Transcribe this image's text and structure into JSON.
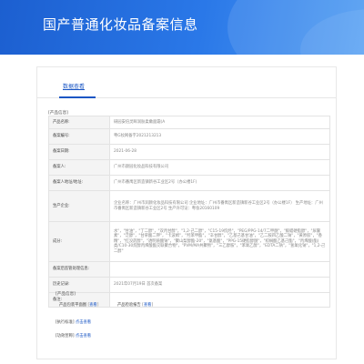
{
  "header": {
    "title": "国产普通化妆品备案信息"
  },
  "tabs": [
    {
      "label": "数据查看"
    }
  ],
  "product_section": {
    "title": "[产品信息]"
  },
  "rows": [
    {
      "label": "产品名称:",
      "value": "研园安倍灵眸润肤柔嫩面霜(A"
    },
    {
      "label": "备案编号:",
      "value": "粤G妆网备字2021213213"
    },
    {
      "label": "备案日期:",
      "value": "2021-06-28"
    },
    {
      "label": "备案人:",
      "value": "广州市颜园化妆品科技有限公司"
    },
    {
      "label": "备案人地址/地址:",
      "value": "广州市番禺区新造镇新谷工业区2号（办公楼1F)"
    },
    {
      "label": "生产企业:",
      "value": "企业名称：广州市润颜化妆品科技有限公司 企业地址：广州市番禺区新造镇新谷工业区2号（办公楼1F） 生产地址：广州市番禺区新造镇新谷工业区2号 生产许可证：粤妆20160109"
    },
    {
      "label": "成分:",
      "value": "水\"，\"甘油\"，\"丁二醇\"，\"双丙甘醇\"，\"1,2-己二醇\"，\"C15-19烷烃\"，\"PEG/PPG-14/7二甲醚\"，\"鲸蜡硬脂醇\"，\"尿囊素\"，\"泛醇\"，\"甘草酸二钾\"，\"卡波姆\"，\"羟苯甲酯\"，\"辛甘醇\"，\"乙基己基甘油\"，\"乙二胺四乙酸二钠\"，\"黄原胶\"，\"香精\"，\"红没药醇\"，\"透明质酸钠\"，\"聚山梨醇酯-20\"，\"氨基酸\"，\"PPG-15硬脂醇醚\"，\"棕榈酸乙基己酯\"，\"丙烯酸(酯)类/C10-30烷醇丙烯酸酯交联聚合物\"，\"PVM/MA共聚物\"，\"三乙醇胺\"，\"苯氧乙醇\"，\"EDTA二钠\"，\"氢氧化钠\"，\"1,2-己二醇\""
    },
    {
      "label": "备案后监管处理信息:",
      "value": ""
    },
    {
      "label": "历史记录:",
      "value": "2021年07月19日  首次备案"
    },
    {
      "label": "备注:",
      "value": ""
    }
  ],
  "images_section": {
    "title": "[产品信息]",
    "items": [
      {
        "label": "产品包装平面图",
        "link": "查看"
      },
      {
        "label": "产品检验报告",
        "link": "查看"
      }
    ]
  },
  "exec_standard": {
    "label": "[执行标准]",
    "link": "点击查看"
  },
  "efficacy": {
    "label": "[功效宣称]",
    "link": "点击查看"
  }
}
